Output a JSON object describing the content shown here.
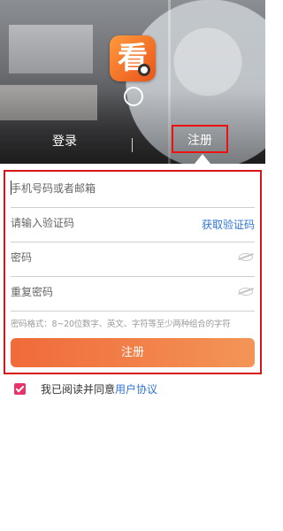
{
  "header": {
    "tabs": [
      {
        "label": "登录",
        "active": false
      },
      {
        "label": "注册",
        "active": true
      }
    ]
  },
  "form": {
    "phone_placeholder": "手机号码或者邮箱",
    "code_placeholder": "请输入验证码",
    "get_code_label": "获取验证码",
    "password_placeholder": "密码",
    "confirm_password_placeholder": "重复密码",
    "password_hint": "密码格式：8~20位数字、英文、字符等至少两种组合的字符",
    "submit_label": "注册"
  },
  "agreement": {
    "text": "我已阅读并同意",
    "link": "用户协议",
    "checked": true
  },
  "colors": {
    "accent": "#f06a3a",
    "link": "#2f74d8",
    "checkbox": "#e8326b",
    "highlight_border": "#d8141b"
  }
}
